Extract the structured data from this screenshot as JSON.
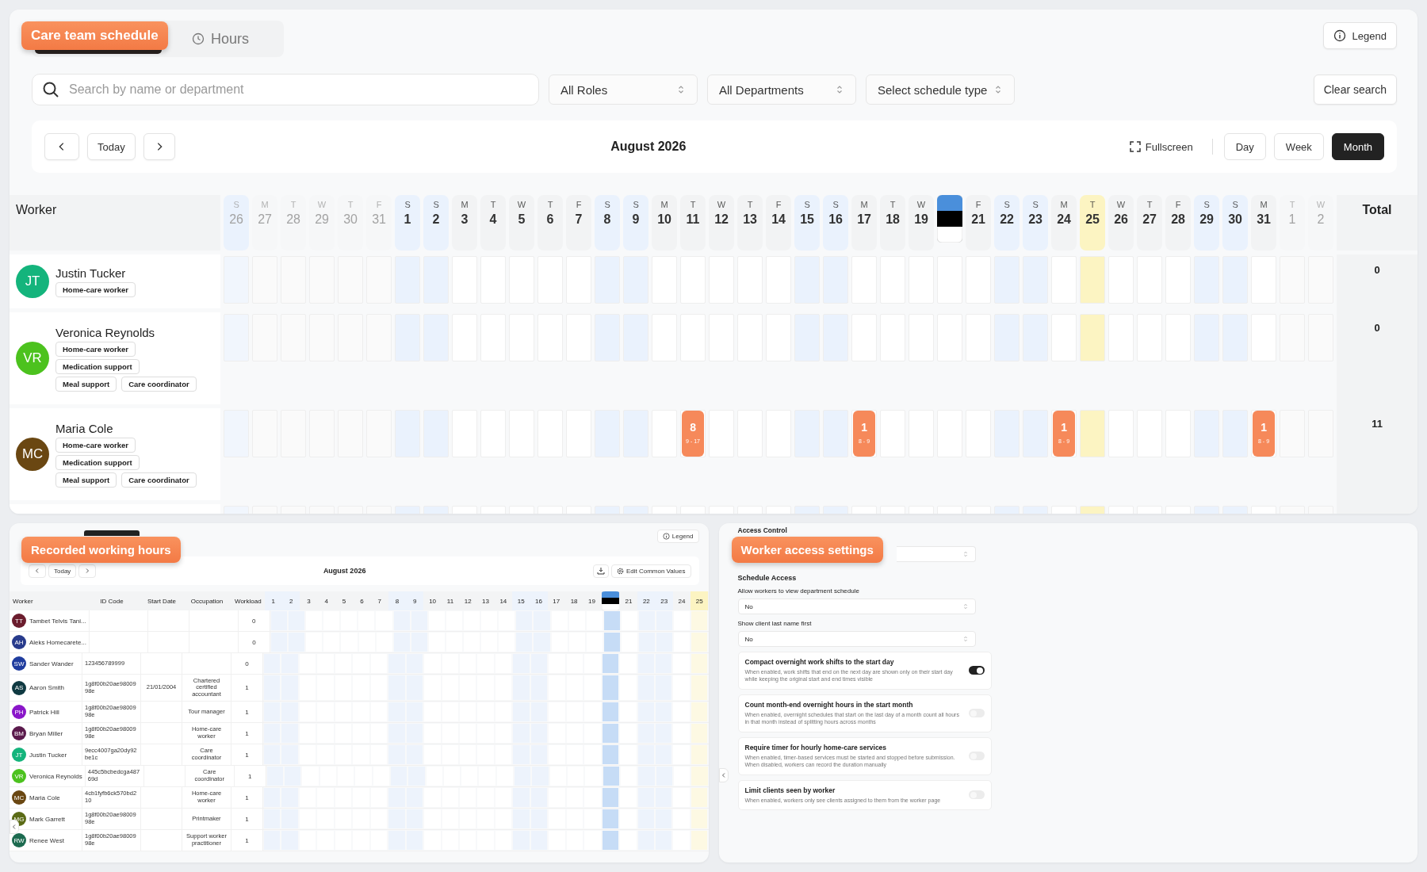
{
  "schedule": {
    "callout": "Care team schedule",
    "tabs": [
      {
        "selected": true
      },
      {
        "label": "Hours",
        "selected": false
      }
    ],
    "legend": "Legend",
    "search": {
      "placeholder": "Search by name or department"
    },
    "filters": [
      "All Roles",
      "All Departments",
      "Select schedule type"
    ],
    "clear": "Clear search",
    "nav": {
      "today": "Today",
      "title": "August 2026",
      "fullscreen": "Fullscreen",
      "views": [
        {
          "label": "Day",
          "selected": false
        },
        {
          "label": "Week",
          "selected": false
        },
        {
          "label": "Month",
          "selected": true
        }
      ]
    },
    "worker_heading": "Worker",
    "total_heading": "Total",
    "days": [
      {
        "dow": "S",
        "day": "26",
        "kind": "weekend",
        "outside": true
      },
      {
        "dow": "M",
        "day": "27",
        "kind": "weekday",
        "outside": true
      },
      {
        "dow": "T",
        "day": "28",
        "kind": "weekday",
        "outside": true
      },
      {
        "dow": "W",
        "day": "29",
        "kind": "weekday",
        "outside": true
      },
      {
        "dow": "T",
        "day": "30",
        "kind": "weekday",
        "outside": true
      },
      {
        "dow": "F",
        "day": "31",
        "kind": "weekday",
        "outside": true
      },
      {
        "dow": "S",
        "day": "1",
        "kind": "weekend",
        "outside": false
      },
      {
        "dow": "S",
        "day": "2",
        "kind": "weekend",
        "outside": false
      },
      {
        "dow": "M",
        "day": "3",
        "kind": "weekday",
        "outside": false
      },
      {
        "dow": "T",
        "day": "4",
        "kind": "weekday",
        "outside": false
      },
      {
        "dow": "W",
        "day": "5",
        "kind": "weekday",
        "outside": false
      },
      {
        "dow": "T",
        "day": "6",
        "kind": "weekday",
        "outside": false
      },
      {
        "dow": "F",
        "day": "7",
        "kind": "weekday",
        "outside": false
      },
      {
        "dow": "S",
        "day": "8",
        "kind": "weekend",
        "outside": false
      },
      {
        "dow": "S",
        "day": "9",
        "kind": "weekend",
        "outside": false
      },
      {
        "dow": "M",
        "day": "10",
        "kind": "weekday",
        "outside": false
      },
      {
        "dow": "T",
        "day": "11",
        "kind": "weekday",
        "outside": false
      },
      {
        "dow": "W",
        "day": "12",
        "kind": "weekday",
        "outside": false
      },
      {
        "dow": "T",
        "day": "13",
        "kind": "weekday",
        "outside": false
      },
      {
        "dow": "F",
        "day": "14",
        "kind": "weekday",
        "outside": false
      },
      {
        "dow": "S",
        "day": "15",
        "kind": "weekend",
        "outside": false
      },
      {
        "dow": "S",
        "day": "16",
        "kind": "weekend",
        "outside": false
      },
      {
        "dow": "M",
        "day": "17",
        "kind": "weekday",
        "outside": false
      },
      {
        "dow": "T",
        "day": "18",
        "kind": "weekday",
        "outside": false
      },
      {
        "dow": "W",
        "day": "19",
        "kind": "weekday",
        "outside": false
      },
      {
        "kind": "holiday"
      },
      {
        "dow": "F",
        "day": "21",
        "kind": "weekday",
        "outside": false
      },
      {
        "dow": "S",
        "day": "22",
        "kind": "weekend",
        "outside": false
      },
      {
        "dow": "S",
        "day": "23",
        "kind": "weekend",
        "outside": false
      },
      {
        "dow": "M",
        "day": "24",
        "kind": "weekday",
        "outside": false
      },
      {
        "dow": "T",
        "day": "25",
        "kind": "today",
        "outside": false
      },
      {
        "dow": "W",
        "day": "26",
        "kind": "weekday",
        "outside": false
      },
      {
        "dow": "T",
        "day": "27",
        "kind": "weekday",
        "outside": false
      },
      {
        "dow": "F",
        "day": "28",
        "kind": "weekday",
        "outside": false
      },
      {
        "dow": "S",
        "day": "29",
        "kind": "weekend",
        "outside": false
      },
      {
        "dow": "S",
        "day": "30",
        "kind": "weekend",
        "outside": false
      },
      {
        "dow": "M",
        "day": "31",
        "kind": "weekday",
        "outside": false
      },
      {
        "dow": "T",
        "day": "1",
        "kind": "weekday",
        "outside": true
      },
      {
        "dow": "W",
        "day": "2",
        "kind": "weekday",
        "outside": true
      }
    ],
    "workers": [
      {
        "initials": "JT",
        "name": "Justin Tucker",
        "color": "#14b47c",
        "tags": [
          "Home-care worker"
        ],
        "total": "0"
      },
      {
        "initials": "VR",
        "name": "Veronica Reynolds",
        "color": "#4cc21e",
        "tags": [
          "Home-care worker",
          "Medication support",
          "Meal support",
          "Care coordinator"
        ],
        "total": "0"
      },
      {
        "initials": "MC",
        "name": "Maria Cole",
        "color": "#6a4712",
        "tags": [
          "Home-care worker",
          "Medication support",
          "Meal support",
          "Care coordinator"
        ],
        "total": "11",
        "cells": [
          {
            "kind": "empty"
          },
          {
            "kind": "empty"
          },
          {
            "kind": "empty"
          },
          {
            "kind": "empty"
          },
          {
            "kind": "empty"
          },
          {
            "kind": "empty"
          },
          {
            "kind": "empty"
          },
          {
            "kind": "empty"
          },
          {
            "kind": "empty"
          },
          {
            "kind": "empty"
          },
          {
            "kind": "empty"
          },
          {
            "kind": "empty"
          },
          {
            "kind": "empty"
          },
          {
            "kind": "empty"
          },
          {
            "kind": "empty"
          },
          {
            "kind": "empty"
          },
          {
            "kind": "shift",
            "hours": "8",
            "time": "9 - 17"
          },
          {
            "kind": "empty"
          },
          {
            "kind": "empty"
          },
          {
            "kind": "empty"
          },
          {
            "kind": "empty"
          },
          {
            "kind": "empty"
          },
          {
            "kind": "shift",
            "hours": "1",
            "time": "8 - 9"
          },
          {
            "kind": "empty"
          },
          {
            "kind": "empty"
          },
          {
            "kind": "empty"
          },
          {
            "kind": "empty"
          },
          {
            "kind": "empty"
          },
          {
            "kind": "empty"
          },
          {
            "kind": "shift",
            "hours": "1",
            "time": "8 - 9"
          },
          {
            "kind": "empty"
          },
          {
            "kind": "empty"
          },
          {
            "kind": "empty"
          },
          {
            "kind": "empty"
          },
          {
            "kind": "empty"
          },
          {
            "kind": "empty"
          },
          {
            "kind": "shift",
            "hours": "1",
            "time": "8 - 9"
          },
          {
            "kind": "empty"
          },
          {
            "kind": "empty"
          }
        ]
      }
    ]
  },
  "hours": {
    "callout": "Recorded working hours",
    "legend": "Legend",
    "nav": {
      "today": "Today",
      "title": "August 2026",
      "edit": "Edit Common Values"
    },
    "columns": [
      "Worker",
      "ID Code",
      "Start Date",
      "Occupation",
      "Workload"
    ],
    "days": [
      {
        "day": "1",
        "kind": "weekend"
      },
      {
        "day": "2",
        "kind": "weekend"
      },
      {
        "day": "3",
        "kind": "weekday"
      },
      {
        "day": "4",
        "kind": "weekday"
      },
      {
        "day": "5",
        "kind": "weekday"
      },
      {
        "day": "6",
        "kind": "weekday"
      },
      {
        "day": "7",
        "kind": "weekday"
      },
      {
        "day": "8",
        "kind": "weekend"
      },
      {
        "day": "9",
        "kind": "weekend"
      },
      {
        "day": "10",
        "kind": "weekday"
      },
      {
        "day": "11",
        "kind": "weekday"
      },
      {
        "day": "12",
        "kind": "weekday"
      },
      {
        "day": "13",
        "kind": "weekday"
      },
      {
        "day": "14",
        "kind": "weekday"
      },
      {
        "day": "15",
        "kind": "weekend"
      },
      {
        "day": "16",
        "kind": "weekend"
      },
      {
        "day": "17",
        "kind": "weekday"
      },
      {
        "day": "18",
        "kind": "weekday"
      },
      {
        "day": "19",
        "kind": "weekday"
      },
      {
        "kind": "holiday"
      },
      {
        "day": "21",
        "kind": "weekday"
      },
      {
        "day": "22",
        "kind": "weekend"
      },
      {
        "day": "23",
        "kind": "weekend"
      },
      {
        "day": "24",
        "kind": "weekday"
      },
      {
        "day": "25",
        "kind": "today"
      }
    ],
    "rows": [
      {
        "initials": "TT",
        "name": "Tambet Telvis Tani...",
        "color": "#6b1d2e",
        "workload": "0"
      },
      {
        "initials": "AH",
        "name": "Aleks Homecarete...",
        "color": "#283b8c",
        "workload": "0"
      },
      {
        "initials": "SW",
        "name": "Sander Wander",
        "color": "#1f3c9e",
        "id_code": "123456789999",
        "workload": "0"
      },
      {
        "initials": "AS",
        "name": "Aaron Smith",
        "color": "#103a42",
        "id_code": "1g8f00b20ae9800998e",
        "start_date": "21/01/2004",
        "occupation": "Chartered certified accountant",
        "workload": "1"
      },
      {
        "initials": "PH",
        "name": "Patrick Hill",
        "color": "#8a16c9",
        "id_code": "1g8f00b20ae9800998e",
        "occupation": "Tour manager",
        "workload": "1"
      },
      {
        "initials": "BM",
        "name": "Bryan Miller",
        "color": "#5b1a4c",
        "id_code": "1g8f00b20ae9800998e",
        "occupation": "Home-care worker",
        "workload": "1"
      },
      {
        "initials": "JT",
        "name": "Justin Tucker",
        "color": "#14b47c",
        "id_code": "9ecc4007ga20dy92be1c",
        "occupation": "Care coordinator",
        "workload": "1"
      },
      {
        "initials": "VR",
        "name": "Veronica Reynolds",
        "color": "#4cc21e",
        "id_code": "445c5bcbedcga48769d",
        "occupation": "Care coordinator",
        "workload": "1"
      },
      {
        "initials": "MC",
        "name": "Maria Cole",
        "color": "#6a4712",
        "id_code": "4cb1fyfb6ck570bd210",
        "occupation": "Home-care worker",
        "workload": "1"
      },
      {
        "initials": "MG",
        "name": "Mark Garrett",
        "color": "#5b6b16",
        "id_code": "1g8f00b20ae9800998e",
        "occupation": "Printmaker",
        "workload": "1"
      },
      {
        "initials": "RW",
        "name": "Renee West",
        "color": "#1d6b50",
        "id_code": "1g8f00b20ae9800998e",
        "occupation": "Support worker practitioner",
        "workload": "1"
      }
    ]
  },
  "settings": {
    "callout": "Worker access settings",
    "section": "Access Control",
    "heading": "Schedule Access",
    "selects": [
      {
        "label": "Allow workers to view department schedule",
        "value": "No"
      },
      {
        "label": "Show client last name first",
        "value": "No"
      }
    ],
    "toggles": [
      {
        "title": "Compact overnight work shifts to the start day",
        "description": "When enabled, work shifts that end on the next day are shown only on their start day while keeping the original start and end times visible",
        "on": true
      },
      {
        "title": "Count month-end overnight hours in the start month",
        "description": "When enabled, overnight schedules that start on the last day of a month count all hours in that month instead of splitting hours across months",
        "on": false
      },
      {
        "title": "Require timer for hourly home-care services",
        "description": "When enabled, timer-based services must be started and stopped before submission. When disabled, workers can record the duration manually",
        "on": false
      },
      {
        "title": "Limit clients seen by worker",
        "description": "When enabled, workers only see clients assigned to them from the worker page",
        "on": false
      }
    ]
  }
}
